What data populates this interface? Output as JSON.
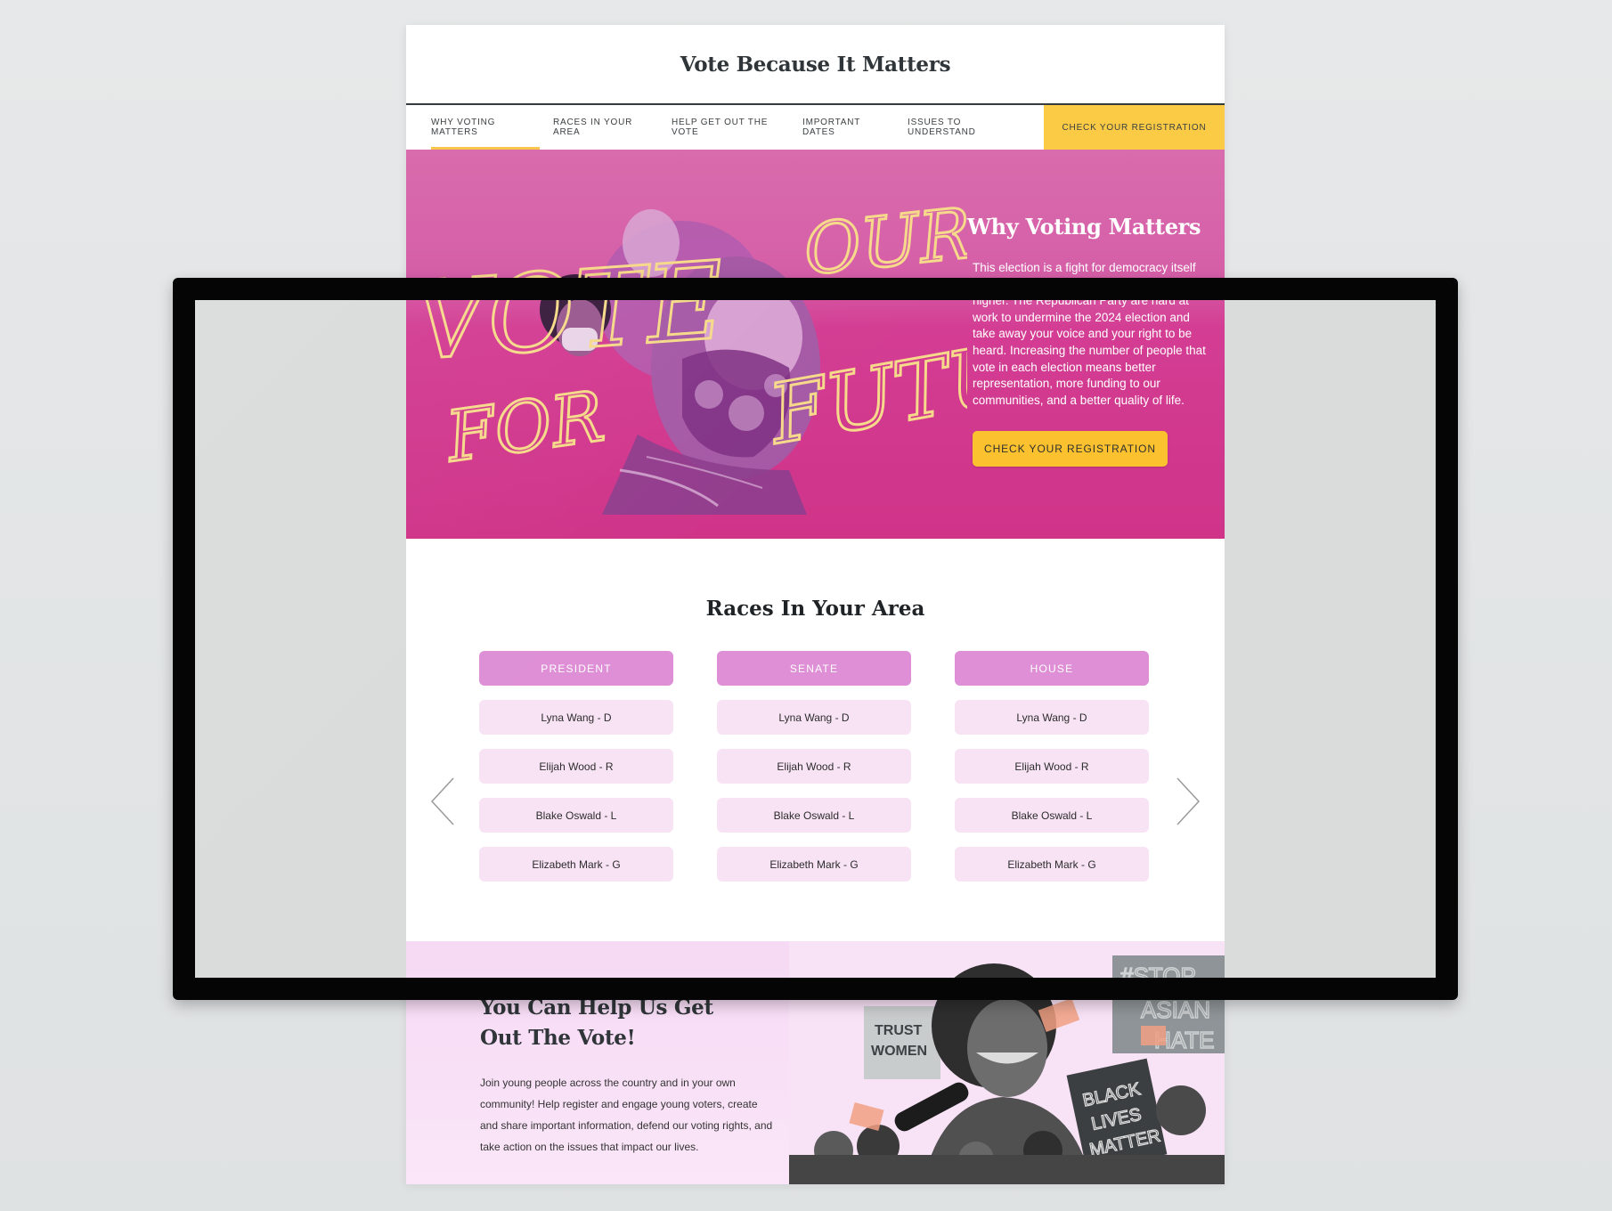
{
  "site": {
    "title": "Vote Because It Matters"
  },
  "nav": {
    "items": [
      {
        "label": "WHY VOTING MATTERS",
        "active": true
      },
      {
        "label": "RACES IN YOUR AREA",
        "active": false
      },
      {
        "label": "HELP GET OUT THE VOTE",
        "active": false
      },
      {
        "label": "IMPORTANT DATES",
        "active": false
      },
      {
        "label": "ISSUES TO UNDERSTAND",
        "active": false
      }
    ],
    "cta_label": "CHECK YOUR REGISTRATION"
  },
  "hero": {
    "art_words": [
      "VOTE",
      "FOR",
      "OUR",
      "FUTURE"
    ],
    "title": "Why Voting Matters",
    "body": "This election is a fight for democracy itself — and the stakes for our rights could not be higher. The Republican Party are hard at work to undermine the 2024 election and take away your voice and your right to be heard. Increasing the number of people that vote in each election means better representation, more funding to our communities, and a better quality of life.",
    "button_label": "CHECK YOUR REGISTRATION"
  },
  "races": {
    "title": "Races In Your Area",
    "columns": [
      {
        "header": "PRESIDENT",
        "candidates": [
          "Lyna Wang - D",
          "Elijah Wood - R",
          "Blake Oswald - L",
          "Elizabeth Mark - G"
        ]
      },
      {
        "header": "SENATE",
        "candidates": [
          "Lyna Wang - D",
          "Elijah Wood - R",
          "Blake Oswald - L",
          "Elizabeth Mark - G"
        ]
      },
      {
        "header": "HOUSE",
        "candidates": [
          "Lyna Wang - D",
          "Elijah Wood - R",
          "Blake Oswald - L",
          "Elizabeth Mark - G"
        ]
      }
    ]
  },
  "gotv": {
    "title_line1": "You Can Help Us Get",
    "title_line2": "Out The Vote!",
    "body": "Join young people across the country and in your own community! Help register and engage young voters, create and share important information, defend our voting rights, and take action on the issues that impact our lives.",
    "signs": {
      "trust_line1": "TRUST",
      "trust_line2": "WOMEN",
      "blm_line1": "BLACK",
      "blm_line2": "LIVES",
      "blm_line3": "MATTER",
      "stop_line1": "#STOP",
      "stop_line2": "ASIAN",
      "stop_line3": "HATE"
    }
  },
  "colors": {
    "hero_pink": "#cf3489",
    "accent_yellow": "#fbc12e",
    "race_header": "#de8fd6",
    "race_cell": "#f8e3f5",
    "gotv_bg": "#f6d9f4"
  }
}
